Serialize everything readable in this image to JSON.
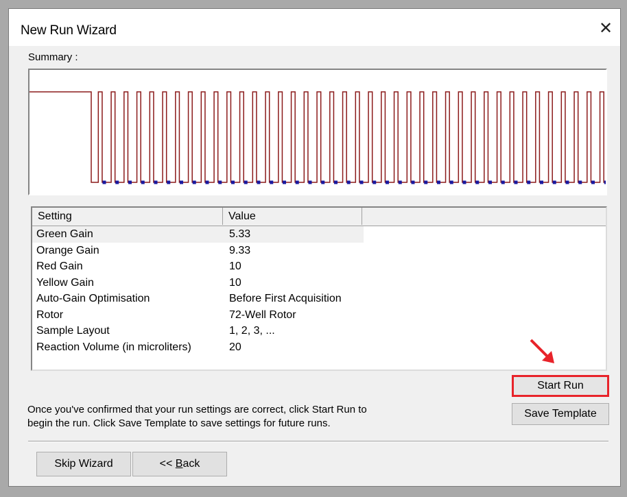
{
  "window": {
    "title": "New Run Wizard",
    "close_glyph": "✕"
  },
  "summary": {
    "label": "Summary :"
  },
  "table": {
    "columns": [
      "Setting",
      "Value",
      ""
    ],
    "rows": [
      {
        "setting": "Green Gain",
        "value": "5.33"
      },
      {
        "setting": "Orange Gain",
        "value": "9.33"
      },
      {
        "setting": "Red Gain",
        "value": "10"
      },
      {
        "setting": "Yellow Gain",
        "value": "10"
      },
      {
        "setting": "Auto-Gain Optimisation",
        "value": "Before First Acquisition"
      },
      {
        "setting": "Rotor",
        "value": "72-Well Rotor"
      },
      {
        "setting": "Sample Layout",
        "value": "1, 2, 3, ..."
      },
      {
        "setting": "Reaction Volume (in microliters)",
        "value": "20"
      }
    ],
    "selected_row": 0
  },
  "buttons": {
    "start_run": "Start Run",
    "save_template": "Save Template",
    "skip_wizard": "Skip Wizard",
    "back_prefix": "<< ",
    "back_underlined": "B",
    "back_suffix": "ack"
  },
  "info": {
    "line1": "Once you've confirmed that your run settings are correct, click Start Run to",
    "line2": "begin the run. Click Save Template to save settings for future runs."
  },
  "profile": {
    "cycles": 40,
    "line_color": "#8b1a1a",
    "marker_color": "#1a1aa0",
    "highlight_color": "#e8232a"
  }
}
